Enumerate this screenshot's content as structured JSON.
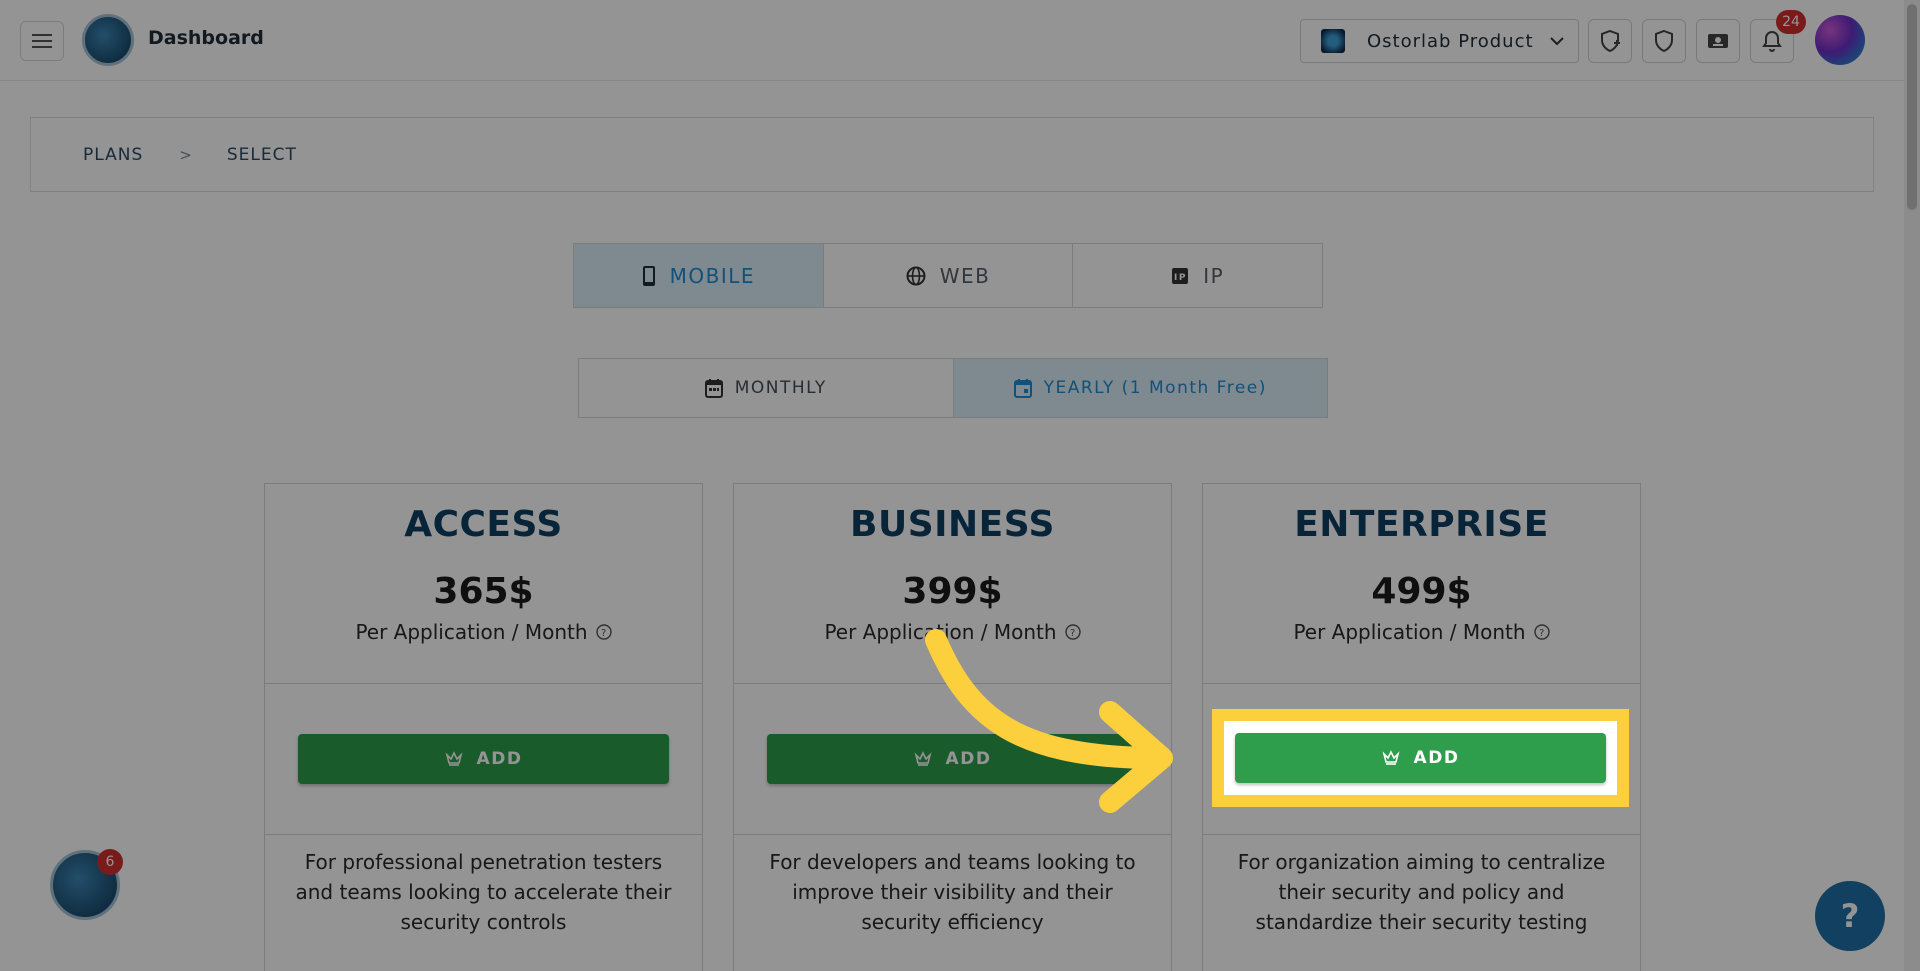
{
  "header": {
    "title": "Dashboard",
    "org_selector": "Ostorlab Product",
    "notification_count": "24"
  },
  "breadcrumb": [
    "PLANS",
    "SELECT"
  ],
  "breadcrumb_separator": ">",
  "tabs": [
    {
      "label": "MOBILE",
      "icon": "smartphone-icon",
      "active": true
    },
    {
      "label": "WEB",
      "icon": "globe-icon",
      "active": false
    },
    {
      "label": "IP",
      "icon": "ip-icon",
      "active": false
    }
  ],
  "billing": [
    {
      "label": "MONTHLY",
      "icon": "calendar-icon",
      "active": false
    },
    {
      "label": "YEARLY (1 Month Free)",
      "icon": "calendar-event-icon",
      "active": true
    }
  ],
  "plans": [
    {
      "name": "ACCESS",
      "price": "365$",
      "unit": "Per Application / Month",
      "button": "ADD",
      "description": "For professional penetration testers and teams looking to accelerate their security controls"
    },
    {
      "name": "BUSINESS",
      "price": "399$",
      "unit": "Per Application / Month",
      "button": "ADD",
      "description": "For developers and teams looking to improve their visibility and their security efficiency"
    },
    {
      "name": "ENTERPRISE",
      "price": "499$",
      "unit": "Per Application / Month",
      "button": "ADD",
      "description": "For organization aiming to centralize their security and policy and standardize their security testing"
    }
  ],
  "chat_button": "?",
  "widget_badge": "6",
  "colors": {
    "accent": "#1e8cd2",
    "add_button": "#2e9e4c",
    "highlight": "#fccf3c",
    "plan_title": "#0f3e63"
  }
}
